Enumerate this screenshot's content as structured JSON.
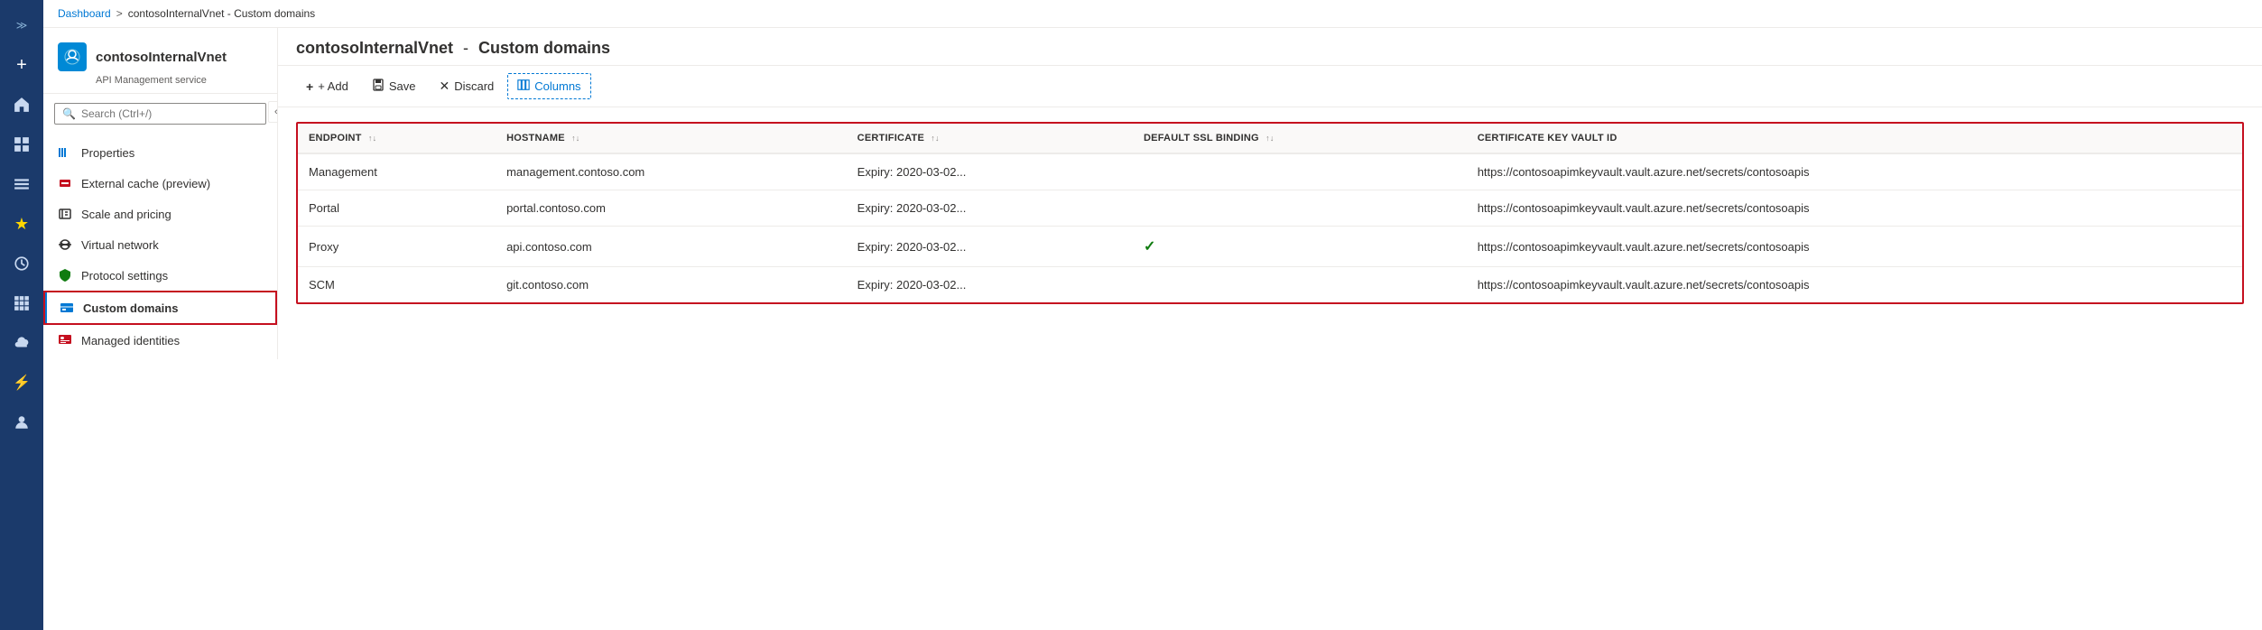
{
  "iconRail": {
    "items": [
      {
        "name": "expand-icon",
        "icon": "≫",
        "label": "Expand"
      },
      {
        "name": "plus-icon",
        "icon": "+",
        "label": "Create"
      },
      {
        "name": "home-icon",
        "icon": "⌂",
        "label": "Home"
      },
      {
        "name": "dashboard-icon",
        "icon": "▦",
        "label": "Dashboard"
      },
      {
        "name": "menu-icon",
        "icon": "☰",
        "label": "Menu"
      },
      {
        "name": "favorites-icon",
        "icon": "★",
        "label": "Favorites"
      },
      {
        "name": "recent-icon",
        "icon": "⏱",
        "label": "Recent"
      },
      {
        "name": "grid-icon",
        "icon": "⊞",
        "label": "All services"
      },
      {
        "name": "cloud-icon",
        "icon": "☁",
        "label": "Cloud"
      },
      {
        "name": "bolt-icon",
        "icon": "⚡",
        "label": ""
      },
      {
        "name": "people-icon",
        "icon": "👤",
        "label": ""
      }
    ]
  },
  "breadcrumb": {
    "dashboard": "Dashboard",
    "separator": ">",
    "current": "contosoInternalVnet - Custom domains"
  },
  "sidebar": {
    "serviceTitle": "contosoInternalVnet - Custom domains",
    "serviceName": "contosoInternalVnet",
    "serviceSubtitle": "API Management service",
    "searchPlaceholder": "Search (Ctrl+/)",
    "collapseIcon": "«",
    "navItems": [
      {
        "id": "properties",
        "label": "Properties",
        "icon": "|||",
        "iconType": "bars"
      },
      {
        "id": "external-cache",
        "label": "External cache (preview)",
        "icon": "🧱",
        "iconType": "cube-red"
      },
      {
        "id": "scale-pricing",
        "label": "Scale and pricing",
        "icon": "✏",
        "iconType": "edit"
      },
      {
        "id": "virtual-network",
        "label": "Virtual network",
        "icon": "⟺",
        "iconType": "network"
      },
      {
        "id": "protocol-settings",
        "label": "Protocol settings",
        "icon": "🛡",
        "iconType": "shield"
      },
      {
        "id": "custom-domains",
        "label": "Custom domains",
        "icon": "⊟",
        "iconType": "domain",
        "active": true
      },
      {
        "id": "managed-identities",
        "label": "Managed identities",
        "icon": "🪪",
        "iconType": "id"
      }
    ]
  },
  "toolbar": {
    "addLabel": "+ Add",
    "saveLabel": "Save",
    "discardLabel": "Discard",
    "columnsLabel": "Columns"
  },
  "table": {
    "columns": [
      {
        "id": "endpoint",
        "label": "ENDPOINT"
      },
      {
        "id": "hostname",
        "label": "HOSTNAME"
      },
      {
        "id": "certificate",
        "label": "CERTIFICATE"
      },
      {
        "id": "defaultSslBinding",
        "label": "DEFAULT SSL BINDING"
      },
      {
        "id": "certificateKeyVaultId",
        "label": "CERTIFICATE KEY VAULT ID"
      }
    ],
    "rows": [
      {
        "endpoint": "Management",
        "hostname": "management.contoso.com",
        "certificate": "Expiry: 2020-03-02...",
        "defaultSslBinding": "",
        "certificateKeyVaultId": "https://contosoapimkeyvault.vault.azure.net/secrets/contosoapis"
      },
      {
        "endpoint": "Portal",
        "hostname": "portal.contoso.com",
        "certificate": "Expiry: 2020-03-02...",
        "defaultSslBinding": "",
        "certificateKeyVaultId": "https://contosoapimkeyvault.vault.azure.net/secrets/contosoapis"
      },
      {
        "endpoint": "Proxy",
        "hostname": "api.contoso.com",
        "certificate": "Expiry: 2020-03-02...",
        "defaultSslBinding": "✓",
        "certificateKeyVaultId": "https://contosoapimkeyvault.vault.azure.net/secrets/contosoapis"
      },
      {
        "endpoint": "SCM",
        "hostname": "git.contoso.com",
        "certificate": "Expiry: 2020-03-02...",
        "defaultSslBinding": "",
        "certificateKeyVaultId": "https://contosoapimkeyvault.vault.azure.net/secrets/contosoapis"
      }
    ]
  },
  "colors": {
    "activeNavBg": "#e8f0f8",
    "accentBlue": "#0078d4",
    "errorRed": "#c50f1f",
    "navOutlineRed": "#c50f1f",
    "greenCheck": "#107c10"
  }
}
